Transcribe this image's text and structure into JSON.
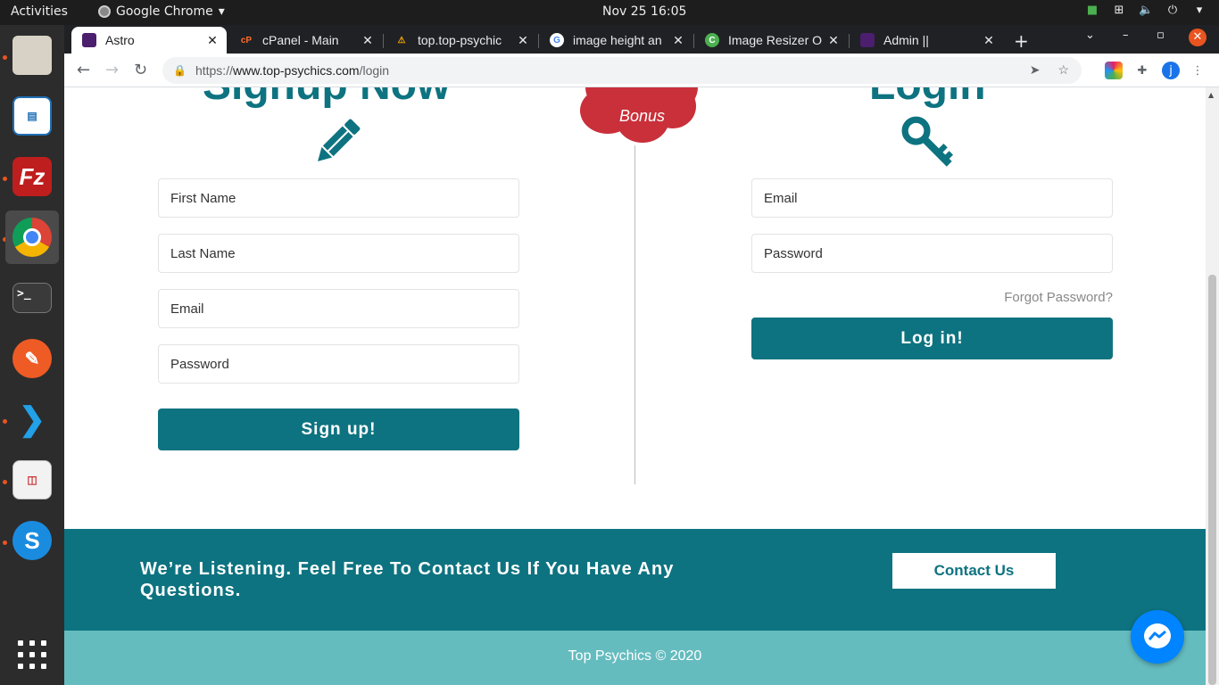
{
  "topbar": {
    "activities": "Activities",
    "app_name": "Google Chrome",
    "clock": "Nov 25  16:05"
  },
  "dock": {
    "items": [
      "files-icon",
      "impress-icon",
      "filezilla-icon",
      "chrome-icon",
      "terminal-icon",
      "postman-icon",
      "vscode-icon",
      "document-reader-icon",
      "skype-icon",
      "app-grid-icon"
    ],
    "terminal_prompt": ">_"
  },
  "tabs": [
    {
      "title": "Astro",
      "active": true
    },
    {
      "title": "cPanel - Main",
      "active": false
    },
    {
      "title": "top.top-psychic",
      "active": false
    },
    {
      "title": "image height an",
      "active": false
    },
    {
      "title": "Image Resizer O",
      "active": false
    },
    {
      "title": "Admin ||",
      "active": false
    }
  ],
  "address_bar": {
    "url_scheme": "https://",
    "url_host": "www.top-psychics.com",
    "url_path": "/login"
  },
  "profile_initial": "j",
  "signup": {
    "heading": "Signup Now",
    "first_name_placeholder": "First Name",
    "last_name_placeholder": "Last Name",
    "email_placeholder": "Email",
    "password_placeholder": "Password",
    "button": "Sign up!"
  },
  "bonus_label": "Bonus",
  "login": {
    "heading": "Login",
    "email_placeholder": "Email",
    "password_placeholder": "Password",
    "forgot": "Forgot Password?",
    "button": "Log in!"
  },
  "contact": {
    "message": "We’re Listening. Feel Free To Contact Us If You Have Any Questions.",
    "button": "Contact Us"
  },
  "footer": {
    "copyright": "Top Psychics © 2020"
  },
  "colors": {
    "primary_teal": "#0e7380",
    "footer_teal": "#65bcbf",
    "bonus_red": "#c9303a",
    "ubuntu_orange": "#e95420"
  }
}
